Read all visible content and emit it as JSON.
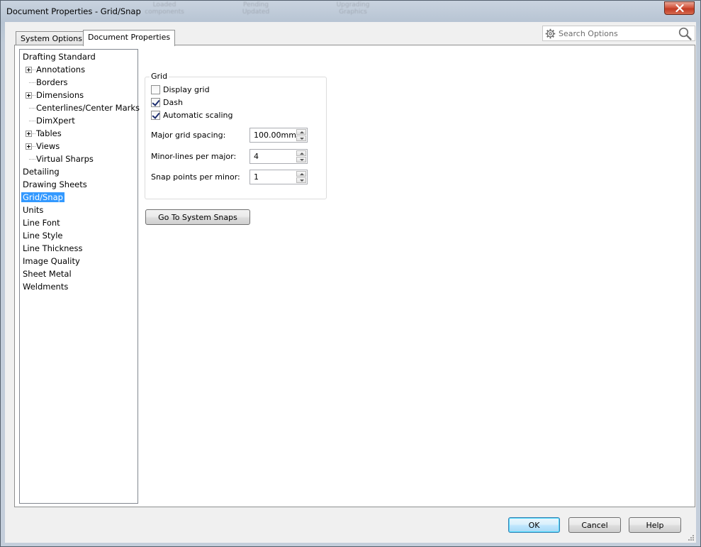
{
  "window": {
    "title": "Document Properties - Grid/Snap",
    "background_toolbar_ghost": [
      "Loaded\ncomponents",
      "Pending\nUpdated",
      "Upgrading\nGraphics"
    ]
  },
  "tabs": [
    {
      "label": "System Options",
      "active": false
    },
    {
      "label": "Document Properties",
      "active": true
    }
  ],
  "search": {
    "placeholder": "Search Options"
  },
  "tree": {
    "items": [
      {
        "label": "Drafting Standard",
        "level": 0,
        "expandable": false,
        "selected": false
      },
      {
        "label": "Annotations",
        "level": 1,
        "expandable": true,
        "selected": false
      },
      {
        "label": "Borders",
        "level": 1,
        "expandable": false,
        "selected": false
      },
      {
        "label": "Dimensions",
        "level": 1,
        "expandable": true,
        "selected": false
      },
      {
        "label": "Centerlines/Center Marks",
        "level": 1,
        "expandable": false,
        "selected": false
      },
      {
        "label": "DimXpert",
        "level": 1,
        "expandable": false,
        "selected": false
      },
      {
        "label": "Tables",
        "level": 1,
        "expandable": true,
        "selected": false
      },
      {
        "label": "Views",
        "level": 1,
        "expandable": true,
        "selected": false
      },
      {
        "label": "Virtual Sharps",
        "level": 1,
        "expandable": false,
        "selected": false
      },
      {
        "label": "Detailing",
        "level": 0,
        "expandable": false,
        "selected": false
      },
      {
        "label": "Drawing Sheets",
        "level": 0,
        "expandable": false,
        "selected": false
      },
      {
        "label": "Grid/Snap",
        "level": 0,
        "expandable": false,
        "selected": true
      },
      {
        "label": "Units",
        "level": 0,
        "expandable": false,
        "selected": false
      },
      {
        "label": "Line Font",
        "level": 0,
        "expandable": false,
        "selected": false
      },
      {
        "label": "Line Style",
        "level": 0,
        "expandable": false,
        "selected": false
      },
      {
        "label": "Line Thickness",
        "level": 0,
        "expandable": false,
        "selected": false
      },
      {
        "label": "Image Quality",
        "level": 0,
        "expandable": false,
        "selected": false
      },
      {
        "label": "Sheet Metal",
        "level": 0,
        "expandable": false,
        "selected": false
      },
      {
        "label": "Weldments",
        "level": 0,
        "expandable": false,
        "selected": false
      }
    ]
  },
  "grid": {
    "legend": "Grid",
    "display_grid": {
      "label": "Display grid",
      "checked": false
    },
    "dash": {
      "label": "Dash",
      "checked": true
    },
    "automatic_scaling": {
      "label": "Automatic scaling",
      "checked": true
    },
    "major_spacing": {
      "label": "Major grid spacing:",
      "value": "100.00mm"
    },
    "minor_lines": {
      "label": "Minor-lines per major:",
      "value": "4"
    },
    "snap_points": {
      "label": "Snap points per minor:",
      "value": "1"
    }
  },
  "go_to_snaps_label": "Go To System Snaps",
  "footer": {
    "ok_label": "OK",
    "cancel_label": "Cancel",
    "help_label": "Help"
  },
  "colors": {
    "selection": "#3399ff",
    "close_button": "#c13b24",
    "default_button_border": "#3c7fb1"
  }
}
